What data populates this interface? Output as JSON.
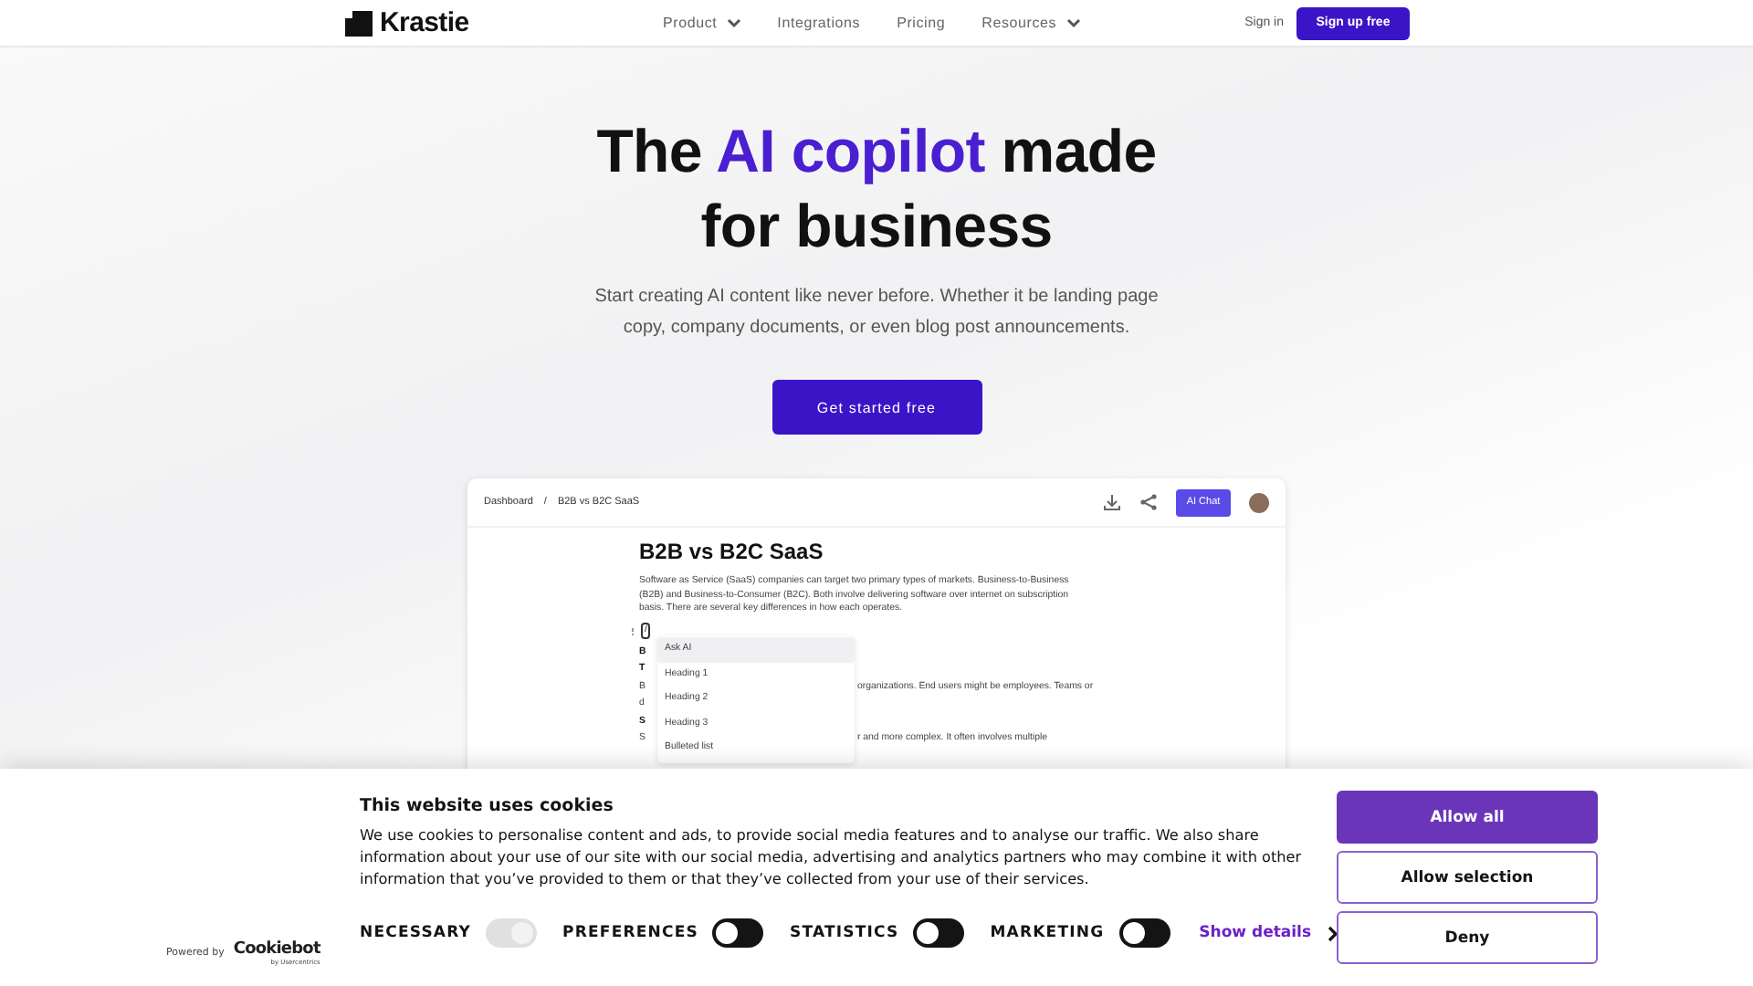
{
  "nav": {
    "logo": "Krastie",
    "links": [
      {
        "label": "Product",
        "dropdown": true
      },
      {
        "label": "Integrations",
        "dropdown": false
      },
      {
        "label": "Pricing",
        "dropdown": false
      },
      {
        "label": "Resources",
        "dropdown": true
      }
    ],
    "sign_in": "Sign in",
    "sign_up": "Sign up free"
  },
  "hero": {
    "title_before": "The ",
    "title_highlight": "AI copilot",
    "title_after": " made for business",
    "subtitle": "Start creating AI content like never before. Whether it be landing page copy, company documents, or even blog post announcements.",
    "cta": "Get started free"
  },
  "app_preview": {
    "breadcrumbs": [
      "Dashboard",
      "B2B vs B2C SaaS"
    ],
    "breadcrumb_separator": "/",
    "ai_chat": "AI Chat",
    "doc_title": "B2B vs B2C SaaS",
    "doc_paragraph": "Software as Service (SaaS) companies can target two primary types of markets. Business-to-Business (B2B) and Business-to-Consumer (B2C). Both involve delivering software over internet on subscription basis. There are several key differences in how each operates.",
    "slash": "/",
    "menu": [
      {
        "label": "Ask AI",
        "selected": true
      },
      {
        "label": "Heading 1",
        "selected": false
      },
      {
        "label": "Heading 2",
        "selected": false
      },
      {
        "label": "Heading 3",
        "selected": false
      },
      {
        "label": "Bulleted list",
        "selected": false
      }
    ],
    "hidden_lines": [
      {
        "left": "B",
        "bold": true
      },
      {
        "left": "T",
        "bold": true
      },
      {
        "left": "B",
        "right": "organizations. End users might be employees. Teams or",
        "bold": false
      },
      {
        "left": "d",
        "bold": false
      },
      {
        "left": "S",
        "bold": true
      },
      {
        "left": "S",
        "right": "r and more complex. It often involves multiple",
        "bold": false
      }
    ]
  },
  "cookie_banner": {
    "powered_by": "Powered by",
    "brand": "Cookiebot",
    "brand_sub": "by Usercentrics",
    "title": "This website uses cookies",
    "text": "We use cookies to personalise content and ads, to provide social media features and to analyse our traffic. We also share information about your use of our site with our social media, advertising and analytics partners who may combine it with other information that you’ve provided to them or that they’ve collected from your use of their services.",
    "toggles": [
      {
        "label": "NECESSARY",
        "on": true,
        "disabled": true
      },
      {
        "label": "PREFERENCES",
        "on": false,
        "disabled": false
      },
      {
        "label": "STATISTICS",
        "on": false,
        "disabled": false
      },
      {
        "label": "MARKETING",
        "on": false,
        "disabled": false
      }
    ],
    "show_details": "Show details",
    "buttons": [
      {
        "label": "Allow all",
        "kind": "primary"
      },
      {
        "label": "Allow selection",
        "kind": "outline"
      },
      {
        "label": "Deny",
        "kind": "outline"
      }
    ]
  }
}
